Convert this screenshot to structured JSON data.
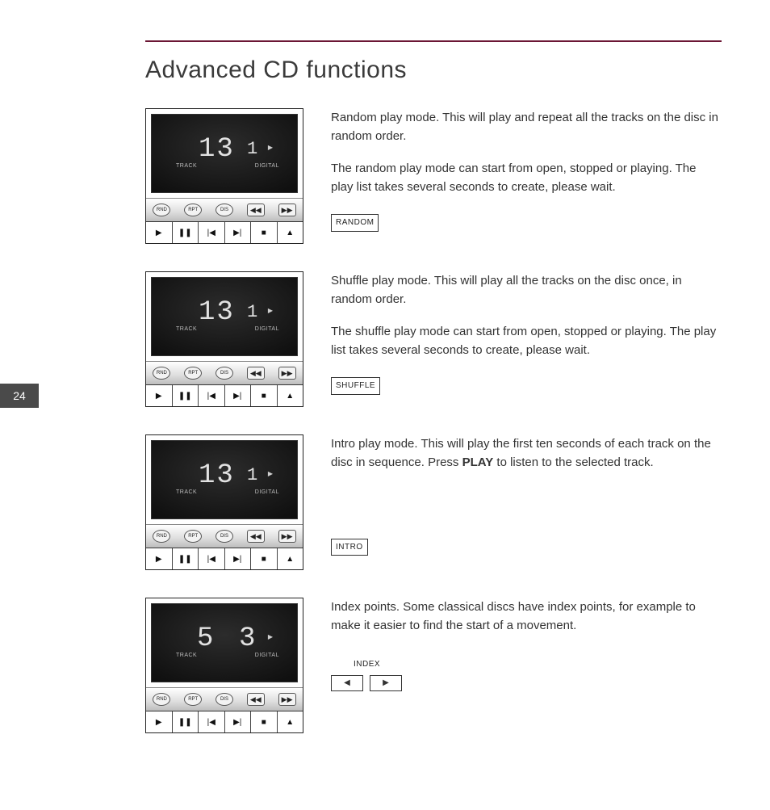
{
  "page_number": "24",
  "title": "Advanced CD functions",
  "panel_labels": {
    "track": "TRACK",
    "digital": "DIGITAL",
    "row1": {
      "rnd": "RND",
      "rpt": "RPT",
      "dis": "DIS",
      "rew": "◀◀",
      "ffwd": "▶▶"
    },
    "row2": {
      "play": "▶",
      "pause": "❚❚",
      "prev": "|◀",
      "next": "▶|",
      "stop": "■",
      "eject": "▲"
    }
  },
  "sections": [
    {
      "id": "random",
      "display": {
        "main": "13",
        "sub": "1",
        "play_indicator": "▶",
        "layout": "main-sub"
      },
      "paragraphs": [
        "Random play mode. This will play and repeat all the tracks on the disc in random order.",
        "The random play mode can start from open, stopped or playing. The play list takes several seconds to create, please wait."
      ],
      "button_label": "RANDOM"
    },
    {
      "id": "shuffle",
      "display": {
        "main": "13",
        "sub": "1",
        "play_indicator": "▶",
        "layout": "main-sub"
      },
      "paragraphs": [
        "Shuffle play mode. This will play all the tracks on the disc once, in random order.",
        "The shuffle play mode can start from open, stopped or playing. The play list takes several seconds to create, please wait."
      ],
      "button_label": "SHUFFLE"
    },
    {
      "id": "intro",
      "display": {
        "main": "13",
        "sub": "1",
        "play_indicator": "▶",
        "layout": "main-sub"
      },
      "paragraphs_rich": [
        {
          "pre": "Intro play mode. This will play the first ten seconds of each track on the disc in sequence. Press ",
          "bold": "PLAY",
          "post": " to listen to the selected track."
        }
      ],
      "button_label": "INTRO"
    },
    {
      "id": "index",
      "display": {
        "left": "5",
        "right": "3",
        "play_indicator": "▶",
        "layout": "pair"
      },
      "paragraphs": [
        "Index points. Some classical discs have index points, for example to make it easier to find the start of a movement."
      ],
      "index_label": "INDEX",
      "index_buttons": {
        "prev": "◀",
        "next": "▶"
      }
    }
  ]
}
